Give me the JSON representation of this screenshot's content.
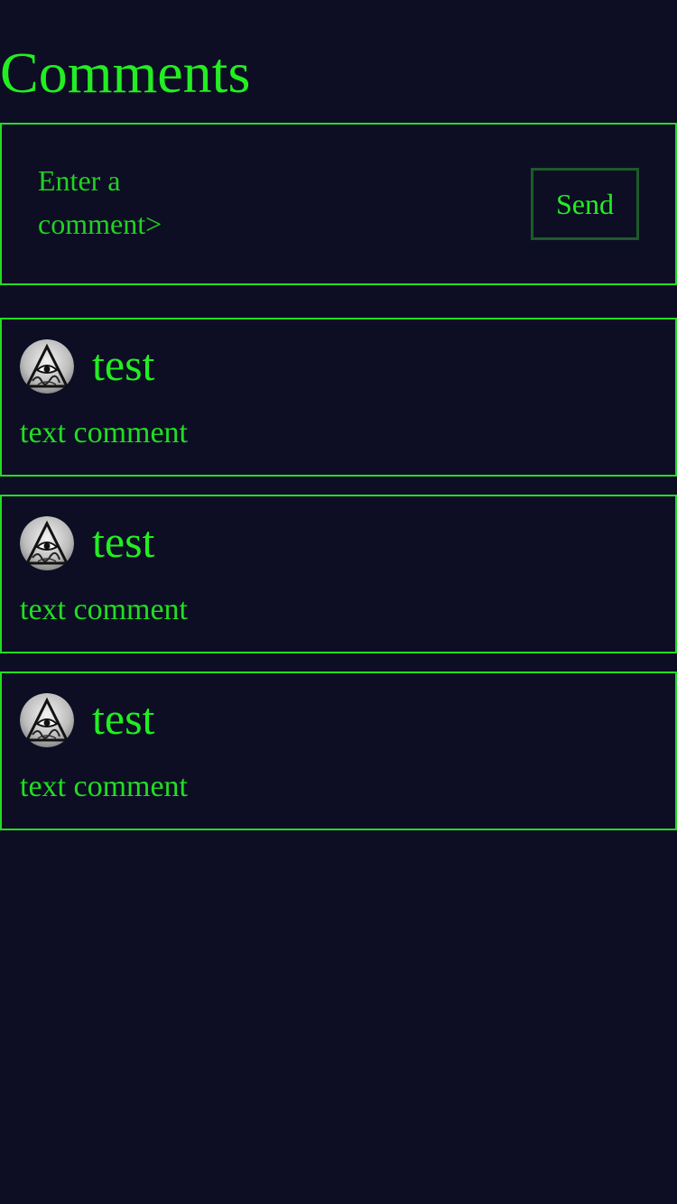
{
  "header": {
    "title": "Comments"
  },
  "composer": {
    "placeholder": "Enter a comment>",
    "send_label": "Send"
  },
  "comments": [
    {
      "author": "test",
      "text": "text comment",
      "avatar_icon": "all-seeing-eye-pyramid-icon"
    },
    {
      "author": "test",
      "text": "text comment",
      "avatar_icon": "all-seeing-eye-pyramid-icon"
    },
    {
      "author": "test",
      "text": "text comment",
      "avatar_icon": "all-seeing-eye-pyramid-icon"
    }
  ],
  "colors": {
    "background": "#0d0e23",
    "accent": "#22ee22",
    "button_border": "#1e5a2a"
  }
}
